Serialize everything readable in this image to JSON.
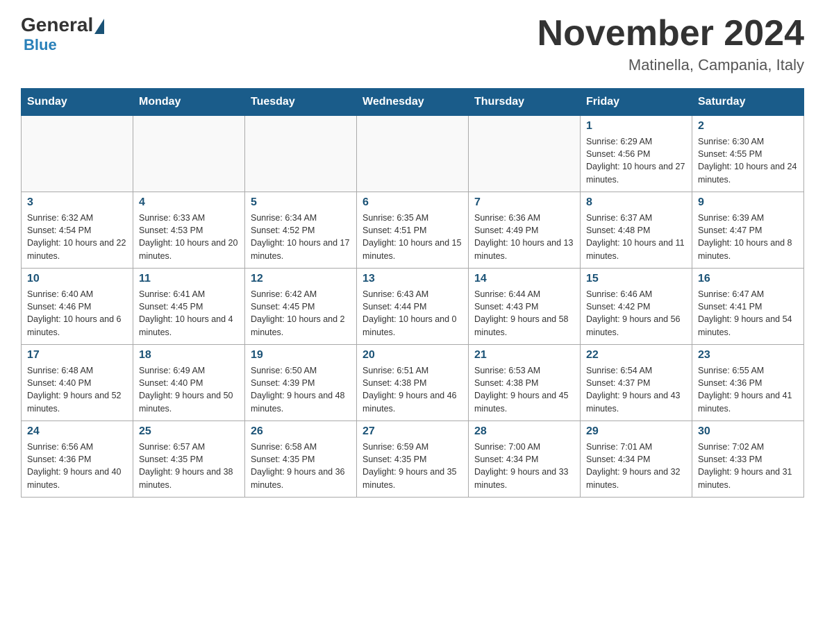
{
  "header": {
    "logo_general": "General",
    "logo_blue": "Blue",
    "month_title": "November 2024",
    "location": "Matinella, Campania, Italy"
  },
  "days_of_week": [
    "Sunday",
    "Monday",
    "Tuesday",
    "Wednesday",
    "Thursday",
    "Friday",
    "Saturday"
  ],
  "weeks": [
    [
      {
        "day": "",
        "info": ""
      },
      {
        "day": "",
        "info": ""
      },
      {
        "day": "",
        "info": ""
      },
      {
        "day": "",
        "info": ""
      },
      {
        "day": "",
        "info": ""
      },
      {
        "day": "1",
        "info": "Sunrise: 6:29 AM\nSunset: 4:56 PM\nDaylight: 10 hours and 27 minutes."
      },
      {
        "day": "2",
        "info": "Sunrise: 6:30 AM\nSunset: 4:55 PM\nDaylight: 10 hours and 24 minutes."
      }
    ],
    [
      {
        "day": "3",
        "info": "Sunrise: 6:32 AM\nSunset: 4:54 PM\nDaylight: 10 hours and 22 minutes."
      },
      {
        "day": "4",
        "info": "Sunrise: 6:33 AM\nSunset: 4:53 PM\nDaylight: 10 hours and 20 minutes."
      },
      {
        "day": "5",
        "info": "Sunrise: 6:34 AM\nSunset: 4:52 PM\nDaylight: 10 hours and 17 minutes."
      },
      {
        "day": "6",
        "info": "Sunrise: 6:35 AM\nSunset: 4:51 PM\nDaylight: 10 hours and 15 minutes."
      },
      {
        "day": "7",
        "info": "Sunrise: 6:36 AM\nSunset: 4:49 PM\nDaylight: 10 hours and 13 minutes."
      },
      {
        "day": "8",
        "info": "Sunrise: 6:37 AM\nSunset: 4:48 PM\nDaylight: 10 hours and 11 minutes."
      },
      {
        "day": "9",
        "info": "Sunrise: 6:39 AM\nSunset: 4:47 PM\nDaylight: 10 hours and 8 minutes."
      }
    ],
    [
      {
        "day": "10",
        "info": "Sunrise: 6:40 AM\nSunset: 4:46 PM\nDaylight: 10 hours and 6 minutes."
      },
      {
        "day": "11",
        "info": "Sunrise: 6:41 AM\nSunset: 4:45 PM\nDaylight: 10 hours and 4 minutes."
      },
      {
        "day": "12",
        "info": "Sunrise: 6:42 AM\nSunset: 4:45 PM\nDaylight: 10 hours and 2 minutes."
      },
      {
        "day": "13",
        "info": "Sunrise: 6:43 AM\nSunset: 4:44 PM\nDaylight: 10 hours and 0 minutes."
      },
      {
        "day": "14",
        "info": "Sunrise: 6:44 AM\nSunset: 4:43 PM\nDaylight: 9 hours and 58 minutes."
      },
      {
        "day": "15",
        "info": "Sunrise: 6:46 AM\nSunset: 4:42 PM\nDaylight: 9 hours and 56 minutes."
      },
      {
        "day": "16",
        "info": "Sunrise: 6:47 AM\nSunset: 4:41 PM\nDaylight: 9 hours and 54 minutes."
      }
    ],
    [
      {
        "day": "17",
        "info": "Sunrise: 6:48 AM\nSunset: 4:40 PM\nDaylight: 9 hours and 52 minutes."
      },
      {
        "day": "18",
        "info": "Sunrise: 6:49 AM\nSunset: 4:40 PM\nDaylight: 9 hours and 50 minutes."
      },
      {
        "day": "19",
        "info": "Sunrise: 6:50 AM\nSunset: 4:39 PM\nDaylight: 9 hours and 48 minutes."
      },
      {
        "day": "20",
        "info": "Sunrise: 6:51 AM\nSunset: 4:38 PM\nDaylight: 9 hours and 46 minutes."
      },
      {
        "day": "21",
        "info": "Sunrise: 6:53 AM\nSunset: 4:38 PM\nDaylight: 9 hours and 45 minutes."
      },
      {
        "day": "22",
        "info": "Sunrise: 6:54 AM\nSunset: 4:37 PM\nDaylight: 9 hours and 43 minutes."
      },
      {
        "day": "23",
        "info": "Sunrise: 6:55 AM\nSunset: 4:36 PM\nDaylight: 9 hours and 41 minutes."
      }
    ],
    [
      {
        "day": "24",
        "info": "Sunrise: 6:56 AM\nSunset: 4:36 PM\nDaylight: 9 hours and 40 minutes."
      },
      {
        "day": "25",
        "info": "Sunrise: 6:57 AM\nSunset: 4:35 PM\nDaylight: 9 hours and 38 minutes."
      },
      {
        "day": "26",
        "info": "Sunrise: 6:58 AM\nSunset: 4:35 PM\nDaylight: 9 hours and 36 minutes."
      },
      {
        "day": "27",
        "info": "Sunrise: 6:59 AM\nSunset: 4:35 PM\nDaylight: 9 hours and 35 minutes."
      },
      {
        "day": "28",
        "info": "Sunrise: 7:00 AM\nSunset: 4:34 PM\nDaylight: 9 hours and 33 minutes."
      },
      {
        "day": "29",
        "info": "Sunrise: 7:01 AM\nSunset: 4:34 PM\nDaylight: 9 hours and 32 minutes."
      },
      {
        "day": "30",
        "info": "Sunrise: 7:02 AM\nSunset: 4:33 PM\nDaylight: 9 hours and 31 minutes."
      }
    ]
  ]
}
